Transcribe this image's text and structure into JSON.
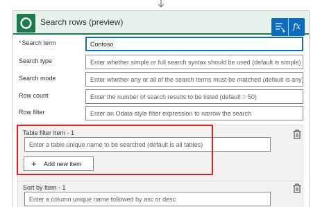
{
  "header": {
    "title": "Search rows (preview)"
  },
  "toolbar": {
    "fx_label": "fx"
  },
  "fields": {
    "search_term": {
      "label": "Search term",
      "value": "Contoso"
    },
    "search_type": {
      "label": "Search type",
      "placeholder": "Enter whether simple or full search syntax should be used (default is simple)"
    },
    "search_mode": {
      "label": "Search mode",
      "placeholder": "Enter whether any or all of the search terms must be matched (default is any)"
    },
    "row_count": {
      "label": "Row count",
      "placeholder": "Enter the number of search results to be listed (default = 50)"
    },
    "row_filter": {
      "label": "Row filter",
      "placeholder": "Enter an Odata style filter expression to narrow the search"
    }
  },
  "table_filter": {
    "title": "Table filter Item - 1",
    "placeholder": "Enter a table unique name to be searched (default is all tables)",
    "add_label": "Add new item"
  },
  "sort_by": {
    "title": "Sort by Item - 1",
    "placeholder": "Enter a column unique name followed by asc or desc"
  },
  "colors": {
    "accent": "#0f6cbd",
    "brand": "#1e7a4b",
    "highlight": "#e02020"
  }
}
